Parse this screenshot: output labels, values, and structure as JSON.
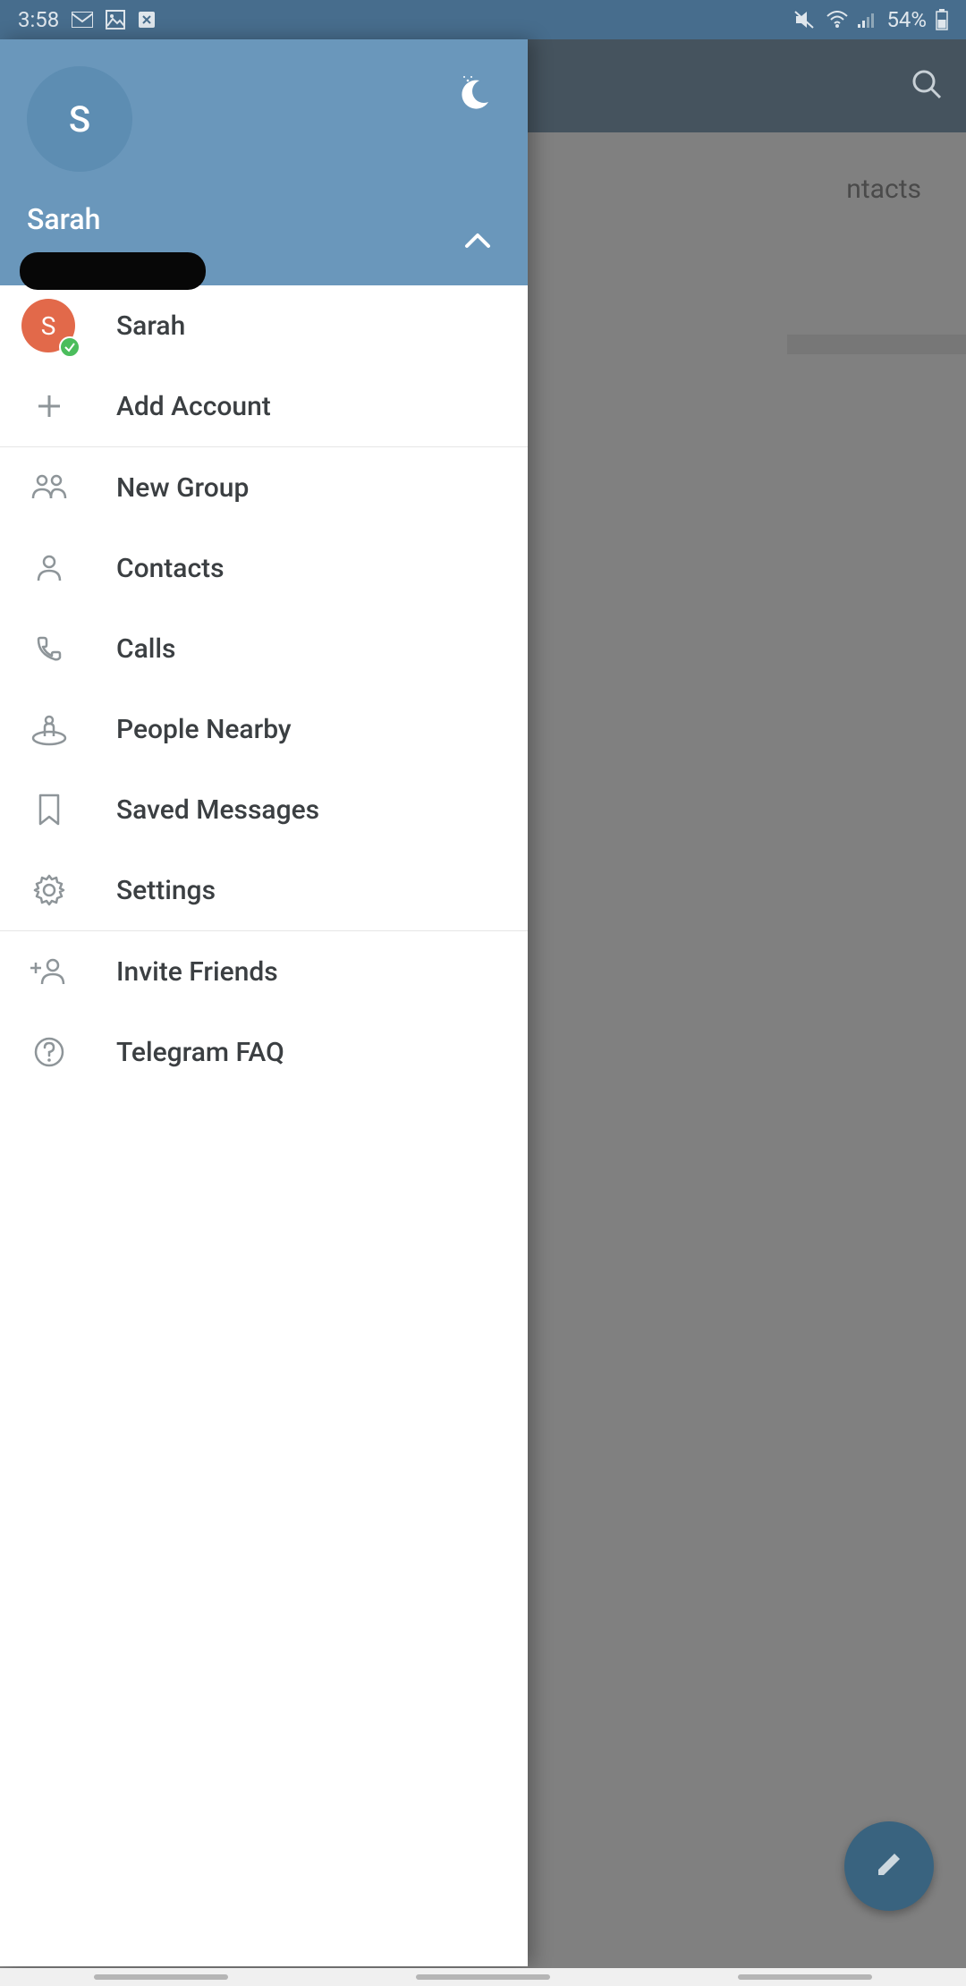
{
  "status": {
    "time": "3:58",
    "battery": "54%"
  },
  "header": {
    "avatar_initial": "S",
    "name": "Sarah"
  },
  "accounts": {
    "current_initial": "S",
    "current_name": "Sarah",
    "add_label": "Add Account"
  },
  "menu": {
    "new_group": "New Group",
    "contacts": "Contacts",
    "calls": "Calls",
    "people_nearby": "People Nearby",
    "saved_messages": "Saved Messages",
    "settings": "Settings",
    "invite_friends": "Invite Friends",
    "faq": "Telegram FAQ"
  },
  "background": {
    "contacts_hint": "ntacts"
  }
}
